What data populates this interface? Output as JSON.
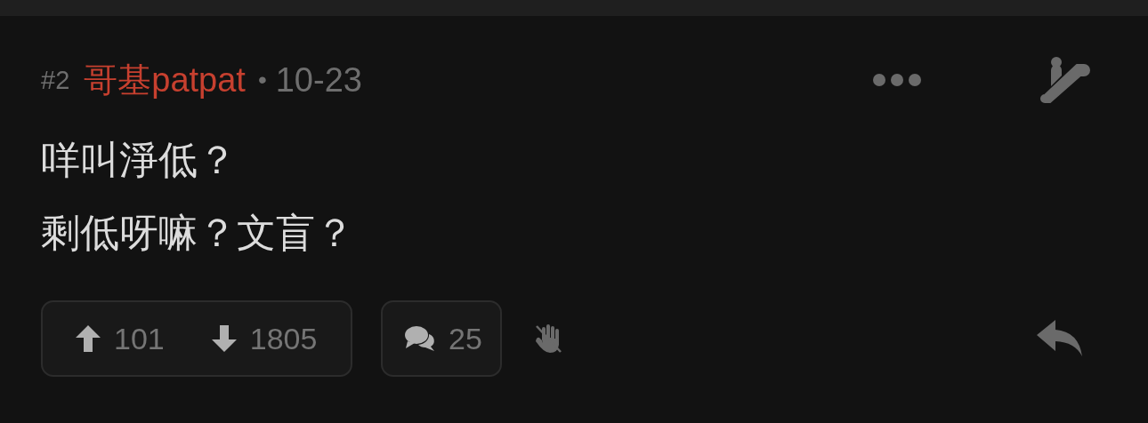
{
  "post": {
    "number": "#2",
    "author": "哥基patpat",
    "separator": "•",
    "date": "10-23",
    "content": [
      "咩叫淨低？",
      "剩低呀嘛？文盲？"
    ],
    "upvotes": "101",
    "downvotes": "1805",
    "comments": "25"
  }
}
